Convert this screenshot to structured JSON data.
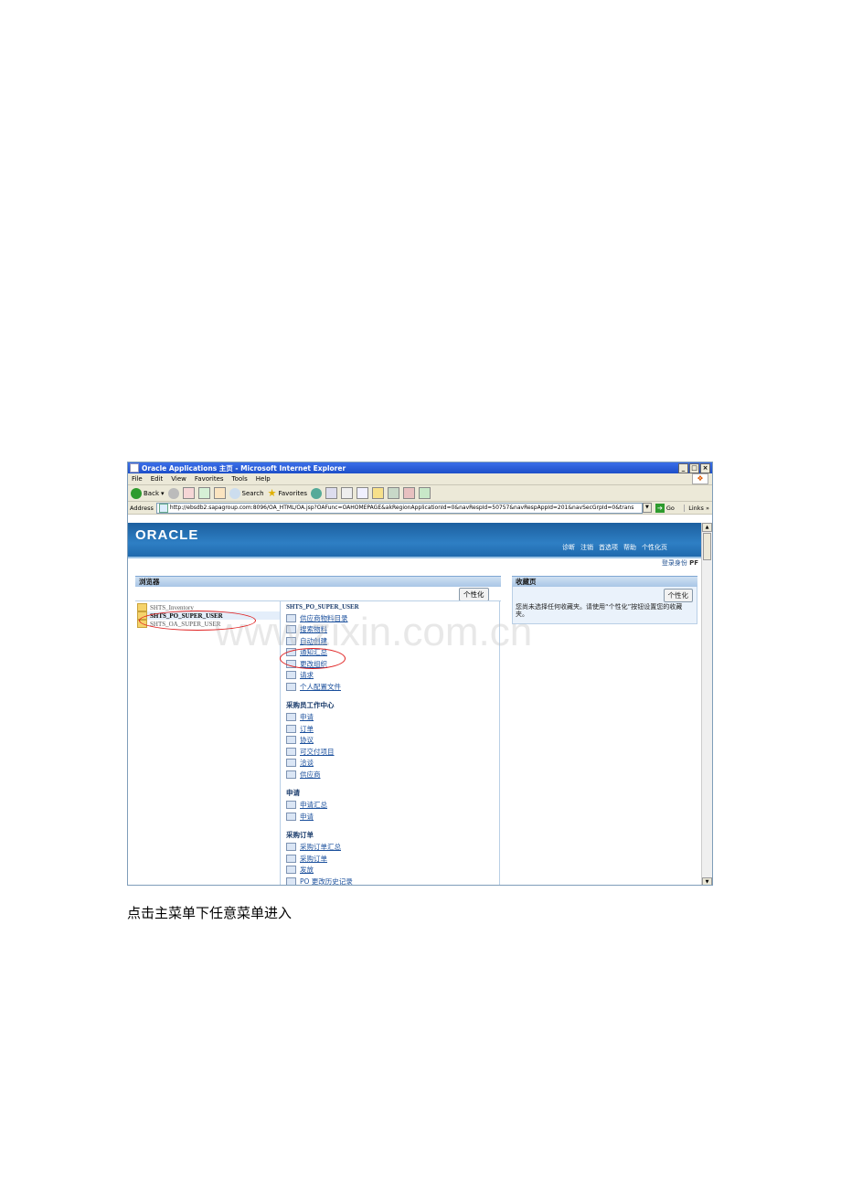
{
  "window": {
    "title": "Oracle Applications 主页 - Microsoft Internet Explorer",
    "controls": [
      "_",
      "□",
      "×"
    ]
  },
  "menubar": [
    "File",
    "Edit",
    "View",
    "Favorites",
    "Tools",
    "Help"
  ],
  "toolbar": {
    "back": "Back",
    "search": "Search",
    "favorites": "Favorites"
  },
  "address": {
    "label": "Address",
    "url": "http://ebsdb2.sapagroup.com:8096/OA_HTML/OA.jsp?OAFunc=OAHOMEPAGE&akRegionApplicationId=0&navRespId=50757&navRespAppId=201&navSecGrpId=0&trans",
    "go": "Go",
    "links": "Links"
  },
  "header": {
    "logo": "ORACLE",
    "global_links": [
      "诊断",
      "注销",
      "首选项",
      "帮助",
      "个性化页"
    ],
    "login_label": "登录身份",
    "login_user": "PF"
  },
  "browser": {
    "title": "浏览器",
    "personalize": "个性化",
    "tree": [
      "SHTS_Inventory",
      "SHTS_PO_SUPER_USER",
      "SHTS_OA_SUPER_USER"
    ],
    "selected_resp": "SHTS_PO_SUPER_USER",
    "links_top": [
      "供应商物料目录",
      "搜索物料",
      "自动创建",
      "通知汇总",
      "更改组织",
      "请求",
      "个人配置文件"
    ],
    "sections": [
      {
        "title": "采购员工作中心",
        "links": [
          "申请",
          "订单",
          "协议",
          "可交付项目",
          "洽谈",
          "供应商"
        ]
      },
      {
        "title": "申请",
        "links": [
          "申请汇总",
          "申请"
        ]
      },
      {
        "title": "采购订单",
        "links": [
          "采购订单汇总",
          "采购订单",
          "发放",
          "PO 更改历史记录"
        ]
      }
    ]
  },
  "favorites": {
    "title": "收藏页",
    "personalize": "个性化",
    "message": "您尚未选择任何收藏夹。请使用“个性化”按钮设置您的收藏夹。"
  },
  "watermark": "www.zixin.com.cn",
  "caption": "点击主菜单下任意菜单进入"
}
